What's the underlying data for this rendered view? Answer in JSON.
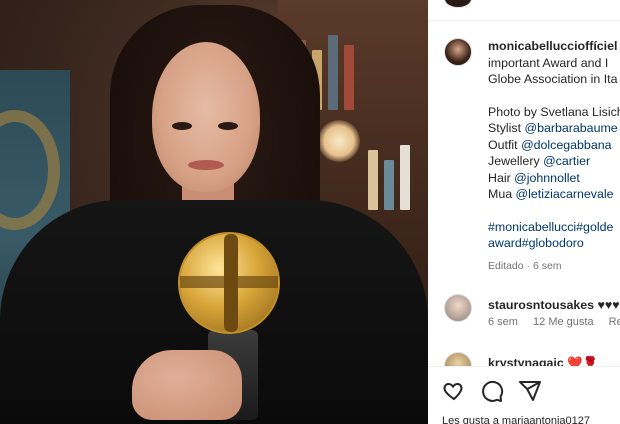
{
  "post": {
    "author": "monicabelluccio fficiel",
    "author_short": "monicabelluccioffíciel",
    "caption_lines": [
      "important Award and I",
      "Globe Association in Ita"
    ],
    "credits": [
      {
        "prefix": "Photo by Svetlana Lisich",
        "link": ""
      },
      {
        "prefix": "Stylist ",
        "link": "@barbarabaume"
      },
      {
        "prefix": "Outfit ",
        "link": "@dolcegabbana"
      },
      {
        "prefix": "Jewellery ",
        "link": "@cartier"
      },
      {
        "prefix": "Hair ",
        "link": "@johnnollet"
      },
      {
        "prefix": "Mua ",
        "link": "@letiziacarnevale"
      }
    ],
    "hashtags_line1": "#monicabellucci#golde",
    "hashtags_line2": "award#globodoro",
    "edited": "Editado · 6 sem"
  },
  "comments": [
    {
      "user": "staurosntousakes",
      "text": "♥♥♥",
      "time": "6 sem",
      "likes": "12 Me gusta",
      "reply": "Resp"
    },
    {
      "user": "krystynagaic",
      "text": "❤️🌹",
      "time": "",
      "likes": "",
      "reply": ""
    }
  ],
  "actions": {
    "like_icon": "heart-icon",
    "comment_icon": "comment-icon",
    "share_icon": "send-icon"
  },
  "likes_text": "Les gusta a mariaantonia0127",
  "colors": {
    "link": "#00376b",
    "muted": "#737373",
    "text": "#262626"
  }
}
